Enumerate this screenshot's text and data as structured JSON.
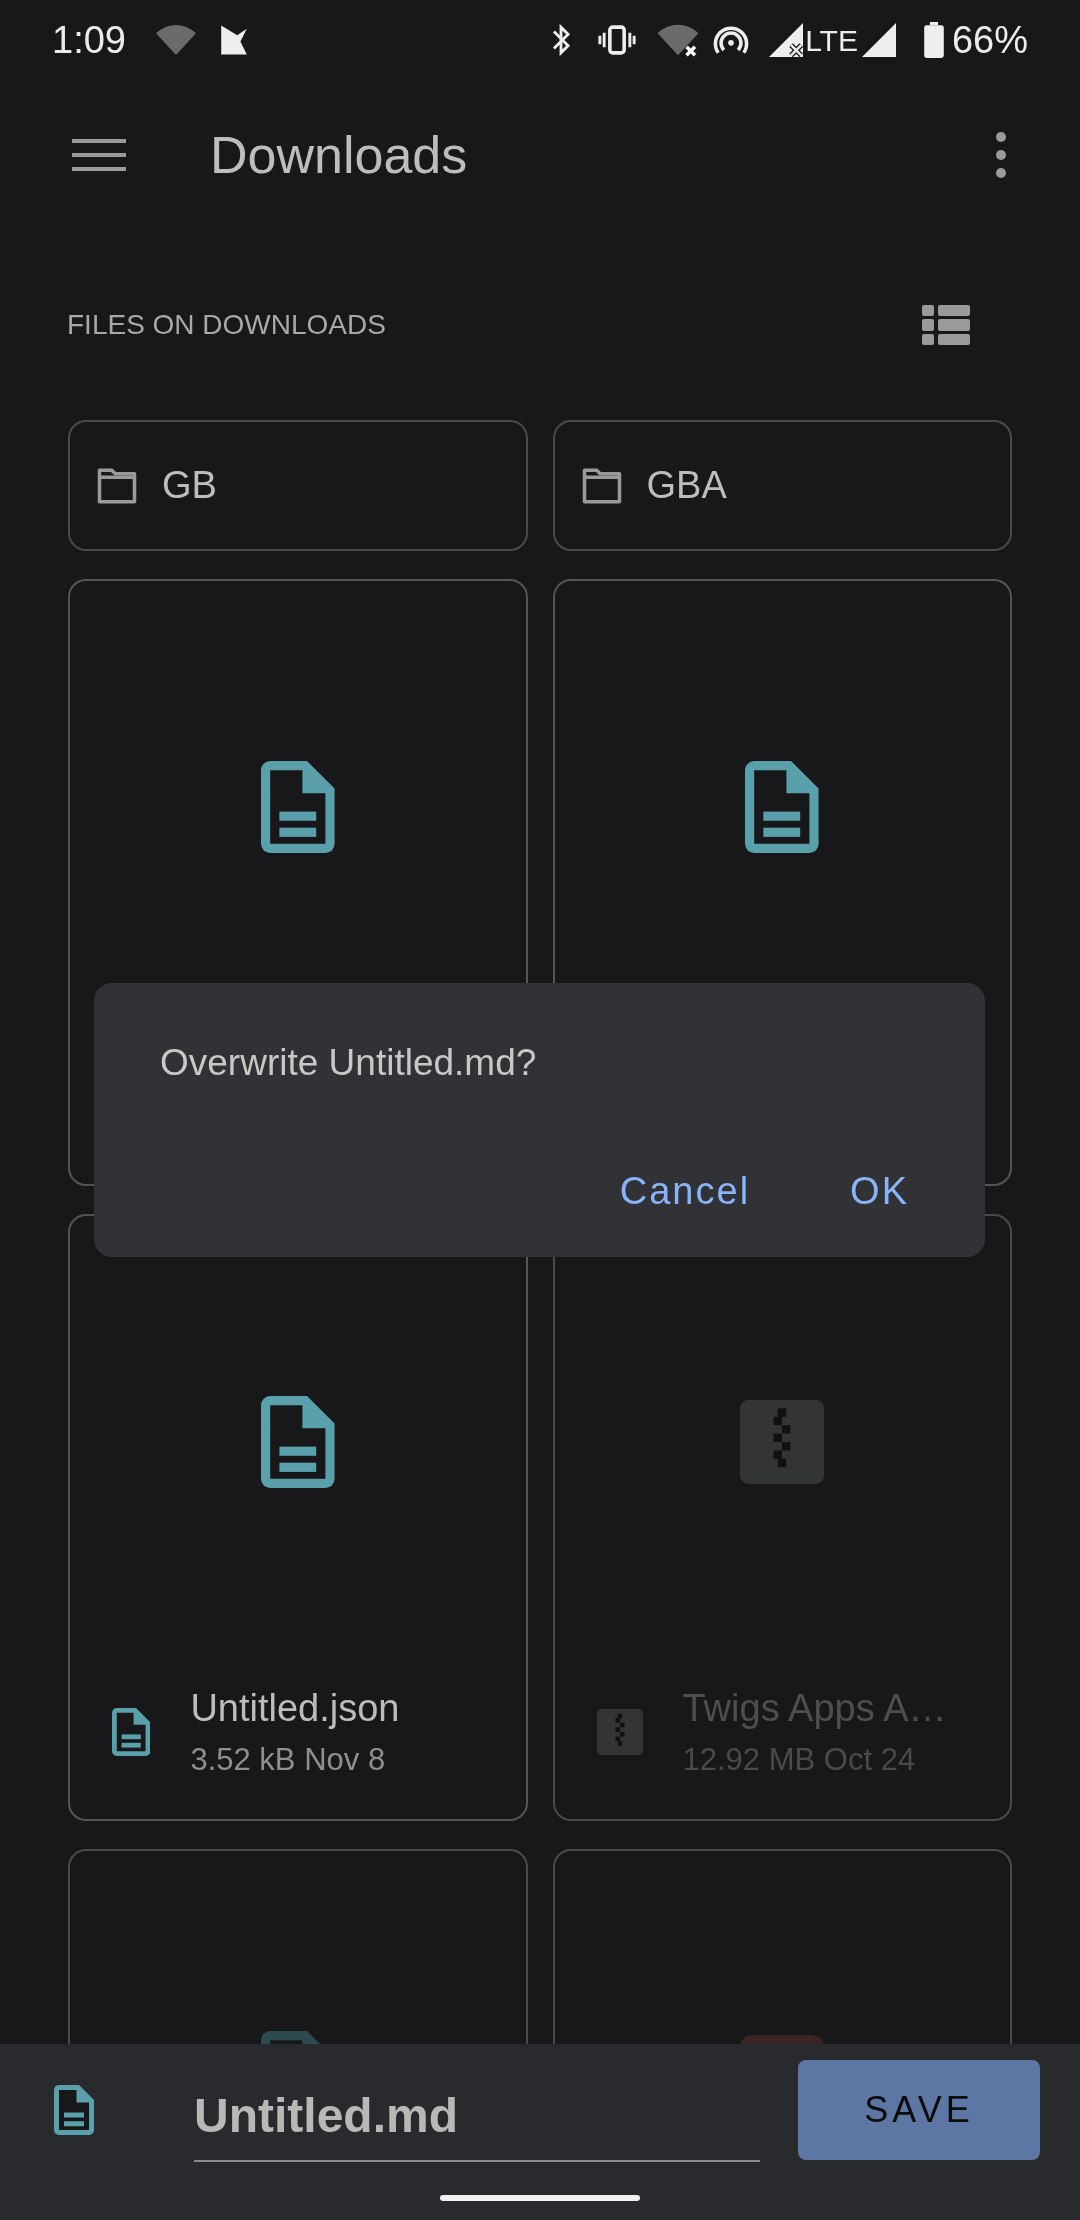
{
  "status_bar": {
    "time": "1:09",
    "network": "LTE",
    "battery": "66%"
  },
  "app_bar": {
    "title": "Downloads"
  },
  "section": {
    "title": "FILES ON DOWNLOADS"
  },
  "folders": [
    {
      "name": "GB"
    },
    {
      "name": "GBA"
    }
  ],
  "files": [
    {
      "kind": "document",
      "disabled": false
    },
    {
      "kind": "document",
      "disabled": false
    },
    {
      "kind": "document",
      "disabled": false,
      "name": "Untitled.json",
      "size": "3.52 kB",
      "date": "Nov 8"
    },
    {
      "kind": "archive",
      "disabled": true,
      "name": "Twigs Apps A…",
      "size": "12.92 MB",
      "date": "Oct 24"
    },
    {
      "kind": "document",
      "disabled": true
    },
    {
      "kind": "other",
      "disabled": true
    }
  ],
  "dialog": {
    "message": "Overwrite Untitled.md?",
    "buttons": [
      "Cancel",
      "OK"
    ]
  },
  "bottom_bar": {
    "filename": "Untitled.md",
    "button": "SAVE"
  }
}
